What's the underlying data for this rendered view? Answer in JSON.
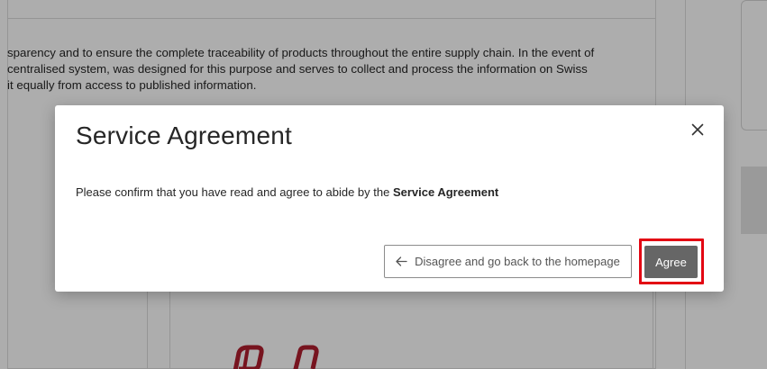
{
  "background": {
    "text_lines": [
      "sparency and to ensure the complete traceability of products throughout the entire supply chain. In the event of",
      "centralised system, was designed for this purpose and serves to collect and process the information on Swiss",
      "it equally from access to published information."
    ]
  },
  "modal": {
    "title": "Service Agreement",
    "body_prefix": "Please confirm that you have read and agree to abide by the ",
    "body_bold": "Service Agreement",
    "close_icon": "close-icon",
    "disagree_label": "Disagree and go back to the homepage",
    "disagree_icon": "arrow-left-icon",
    "agree_label": "Agree"
  },
  "colors": {
    "highlight": "#e30613",
    "agree_button": "#666666",
    "logo": "#b01e2e"
  }
}
